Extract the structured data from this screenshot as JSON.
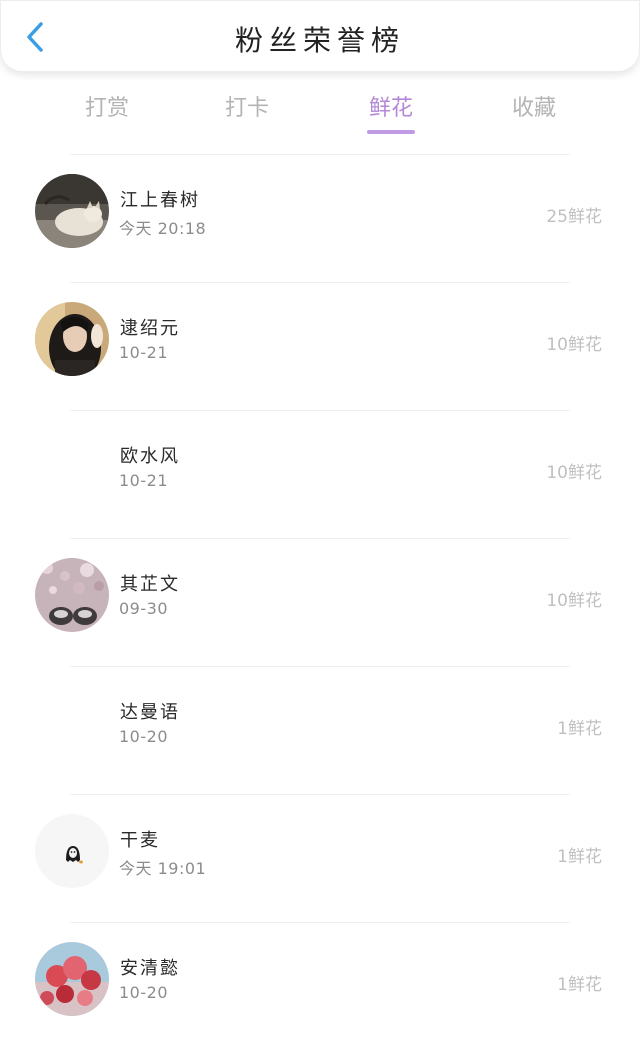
{
  "header": {
    "title": "粉丝荣誉榜",
    "back_icon": "chevron-left-icon",
    "accent_color": "#3a9ee6"
  },
  "tabs": [
    {
      "label": "打赏",
      "active": false
    },
    {
      "label": "打卡",
      "active": false
    },
    {
      "label": "鲜花",
      "active": true
    },
    {
      "label": "收藏",
      "active": false
    }
  ],
  "active_tab_color": "#b488d8",
  "fans": [
    {
      "name": "江上春树",
      "time": "今天 20:18",
      "count": "25鲜花",
      "avatar": "cat-photo"
    },
    {
      "name": "逮绍元",
      "time": "10-21",
      "count": "10鲜花",
      "avatar": "woman-photo"
    },
    {
      "name": "欧水风",
      "time": "10-21",
      "count": "10鲜花",
      "avatar": "none"
    },
    {
      "name": "其芷文",
      "time": "09-30",
      "count": "10鲜花",
      "avatar": "blossom-shoes-photo"
    },
    {
      "name": "达曼语",
      "time": "10-20",
      "count": "1鲜花",
      "avatar": "none"
    },
    {
      "name": "干麦",
      "time": "今天 19:01",
      "count": "1鲜花",
      "avatar": "ghost-illustration"
    },
    {
      "name": "安清懿",
      "time": "10-20",
      "count": "1鲜花",
      "avatar": "balloons-photo"
    }
  ]
}
